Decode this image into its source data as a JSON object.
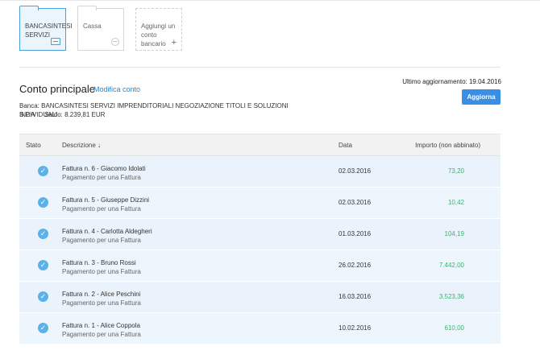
{
  "accounts": [
    {
      "label": "BANCASINTESI SERVIZI"
    },
    {
      "label": "Cassa"
    },
    {
      "label": "Aggiungi un conto bancario"
    }
  ],
  "account": {
    "title": "Conto principale",
    "edit_link": "Modifica conto",
    "last_update": "Ultimo aggiornamento: 19.04.2016",
    "update_button": "Aggiorna",
    "bank_line1": "Banca: BANCASINTESI SERVIZI IMPRENDITORIALI NEGOZIAZIONE TITOLI E SOLUZIONI INDIVIDUALI",
    "bank_line2": "S.P.A",
    "balance": "Saldo: 8.239,81 EUR"
  },
  "table": {
    "headers": {
      "stato": "Stato",
      "descrizione": "Descrizione",
      "sort_arrow": "↓",
      "data": "Data",
      "importo": "Importo (non abbinato)"
    },
    "rows": [
      {
        "title": "Fattura n. 6 - Giacomo Idolati",
        "sub": "Pagamento per una Fattura",
        "date": "02.03.2016",
        "amount": "73,20"
      },
      {
        "title": "Fattura n. 5 - Giuseppe Dizzini",
        "sub": "Pagamento per una Fattura",
        "date": "02.03.2016",
        "amount": "10,42"
      },
      {
        "title": "Fattura n. 4 - Carlotta Aldegheri",
        "sub": "Pagamento per una Fattura",
        "date": "01.03.2016",
        "amount": "104,19"
      },
      {
        "title": "Fattura n. 3 - Bruno Rossi",
        "sub": "Pagamento per una Fattura",
        "date": "26.02.2016",
        "amount": "7.442,00"
      },
      {
        "title": "Fattura n. 2 - Alice Peschini",
        "sub": "Pagamento per una Fattura",
        "date": "16.03.2016",
        "amount": "3.523,36"
      },
      {
        "title": "Fattura n. 1 - Alice Coppola",
        "sub": "Pagamento per una Fattura",
        "date": "10.02.2016",
        "amount": "610,00"
      }
    ]
  },
  "colors": {
    "accent": "#3a8ee3",
    "amount": "#3fb070",
    "row_bg": "#eef6fd"
  }
}
